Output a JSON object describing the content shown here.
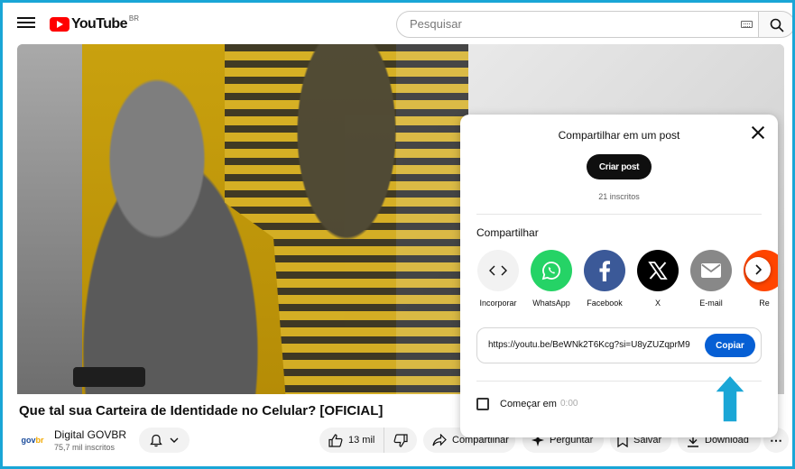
{
  "header": {
    "logo_text": "YouTube",
    "logo_region": "BR",
    "search_placeholder": "Pesquisar"
  },
  "video": {
    "title": "Que tal sua Carteira de Identidade no Celular? [OFICIAL]",
    "channel_logo_text_1": "gov",
    "channel_logo_text_2": "br",
    "channel_name": "Digital GOVBR",
    "channel_subs": "75,7 mil inscritos"
  },
  "actions": {
    "likes": "13 mil",
    "share": "Compartilhar",
    "ask": "Perguntar",
    "save": "Salvar",
    "download": "Download",
    "more": "⋯"
  },
  "dialog": {
    "post_heading": "Compartilhar em um post",
    "create_post": "Criar post",
    "subs_count": "21 inscritos",
    "share_heading": "Compartilhar",
    "targets": [
      {
        "label": "Incorporar",
        "color": "#f2f2f2",
        "icon": "embed-icon"
      },
      {
        "label": "WhatsApp",
        "color": "#25d366",
        "icon": "whatsapp-icon"
      },
      {
        "label": "Facebook",
        "color": "#3b5998",
        "icon": "facebook-icon"
      },
      {
        "label": "X",
        "color": "#000000",
        "icon": "x-icon"
      },
      {
        "label": "E-mail",
        "color": "#888888",
        "icon": "email-icon"
      },
      {
        "label": "Re",
        "color": "#ff4500",
        "icon": "reddit-icon"
      }
    ],
    "link": "https://youtu.be/BeWNk2T6Kcg?si=U8yZUZqprM9",
    "copy": "Copiar",
    "start_label": "Começar em",
    "start_time": "0:00"
  },
  "colors": {
    "accent": "#065fd4",
    "frame": "#1aa6d6",
    "pointer_arrow": "#1aa6d6"
  }
}
